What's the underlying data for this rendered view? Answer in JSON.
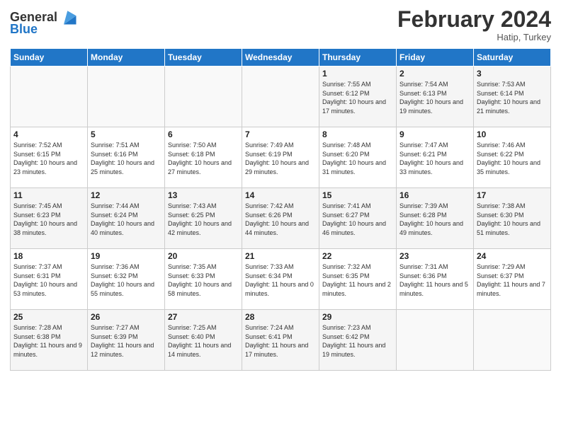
{
  "logo": {
    "text_general": "General",
    "text_blue": "Blue"
  },
  "title": "February 2024",
  "subtitle": "Hatip, Turkey",
  "header_days": [
    "Sunday",
    "Monday",
    "Tuesday",
    "Wednesday",
    "Thursday",
    "Friday",
    "Saturday"
  ],
  "weeks": [
    [
      {
        "day": "",
        "info": ""
      },
      {
        "day": "",
        "info": ""
      },
      {
        "day": "",
        "info": ""
      },
      {
        "day": "",
        "info": ""
      },
      {
        "day": "1",
        "info": "Sunrise: 7:55 AM\nSunset: 6:12 PM\nDaylight: 10 hours and 17 minutes."
      },
      {
        "day": "2",
        "info": "Sunrise: 7:54 AM\nSunset: 6:13 PM\nDaylight: 10 hours and 19 minutes."
      },
      {
        "day": "3",
        "info": "Sunrise: 7:53 AM\nSunset: 6:14 PM\nDaylight: 10 hours and 21 minutes."
      }
    ],
    [
      {
        "day": "4",
        "info": "Sunrise: 7:52 AM\nSunset: 6:15 PM\nDaylight: 10 hours and 23 minutes."
      },
      {
        "day": "5",
        "info": "Sunrise: 7:51 AM\nSunset: 6:16 PM\nDaylight: 10 hours and 25 minutes."
      },
      {
        "day": "6",
        "info": "Sunrise: 7:50 AM\nSunset: 6:18 PM\nDaylight: 10 hours and 27 minutes."
      },
      {
        "day": "7",
        "info": "Sunrise: 7:49 AM\nSunset: 6:19 PM\nDaylight: 10 hours and 29 minutes."
      },
      {
        "day": "8",
        "info": "Sunrise: 7:48 AM\nSunset: 6:20 PM\nDaylight: 10 hours and 31 minutes."
      },
      {
        "day": "9",
        "info": "Sunrise: 7:47 AM\nSunset: 6:21 PM\nDaylight: 10 hours and 33 minutes."
      },
      {
        "day": "10",
        "info": "Sunrise: 7:46 AM\nSunset: 6:22 PM\nDaylight: 10 hours and 35 minutes."
      }
    ],
    [
      {
        "day": "11",
        "info": "Sunrise: 7:45 AM\nSunset: 6:23 PM\nDaylight: 10 hours and 38 minutes."
      },
      {
        "day": "12",
        "info": "Sunrise: 7:44 AM\nSunset: 6:24 PM\nDaylight: 10 hours and 40 minutes."
      },
      {
        "day": "13",
        "info": "Sunrise: 7:43 AM\nSunset: 6:25 PM\nDaylight: 10 hours and 42 minutes."
      },
      {
        "day": "14",
        "info": "Sunrise: 7:42 AM\nSunset: 6:26 PM\nDaylight: 10 hours and 44 minutes."
      },
      {
        "day": "15",
        "info": "Sunrise: 7:41 AM\nSunset: 6:27 PM\nDaylight: 10 hours and 46 minutes."
      },
      {
        "day": "16",
        "info": "Sunrise: 7:39 AM\nSunset: 6:28 PM\nDaylight: 10 hours and 49 minutes."
      },
      {
        "day": "17",
        "info": "Sunrise: 7:38 AM\nSunset: 6:30 PM\nDaylight: 10 hours and 51 minutes."
      }
    ],
    [
      {
        "day": "18",
        "info": "Sunrise: 7:37 AM\nSunset: 6:31 PM\nDaylight: 10 hours and 53 minutes."
      },
      {
        "day": "19",
        "info": "Sunrise: 7:36 AM\nSunset: 6:32 PM\nDaylight: 10 hours and 55 minutes."
      },
      {
        "day": "20",
        "info": "Sunrise: 7:35 AM\nSunset: 6:33 PM\nDaylight: 10 hours and 58 minutes."
      },
      {
        "day": "21",
        "info": "Sunrise: 7:33 AM\nSunset: 6:34 PM\nDaylight: 11 hours and 0 minutes."
      },
      {
        "day": "22",
        "info": "Sunrise: 7:32 AM\nSunset: 6:35 PM\nDaylight: 11 hours and 2 minutes."
      },
      {
        "day": "23",
        "info": "Sunrise: 7:31 AM\nSunset: 6:36 PM\nDaylight: 11 hours and 5 minutes."
      },
      {
        "day": "24",
        "info": "Sunrise: 7:29 AM\nSunset: 6:37 PM\nDaylight: 11 hours and 7 minutes."
      }
    ],
    [
      {
        "day": "25",
        "info": "Sunrise: 7:28 AM\nSunset: 6:38 PM\nDaylight: 11 hours and 9 minutes."
      },
      {
        "day": "26",
        "info": "Sunrise: 7:27 AM\nSunset: 6:39 PM\nDaylight: 11 hours and 12 minutes."
      },
      {
        "day": "27",
        "info": "Sunrise: 7:25 AM\nSunset: 6:40 PM\nDaylight: 11 hours and 14 minutes."
      },
      {
        "day": "28",
        "info": "Sunrise: 7:24 AM\nSunset: 6:41 PM\nDaylight: 11 hours and 17 minutes."
      },
      {
        "day": "29",
        "info": "Sunrise: 7:23 AM\nSunset: 6:42 PM\nDaylight: 11 hours and 19 minutes."
      },
      {
        "day": "",
        "info": ""
      },
      {
        "day": "",
        "info": ""
      }
    ]
  ]
}
